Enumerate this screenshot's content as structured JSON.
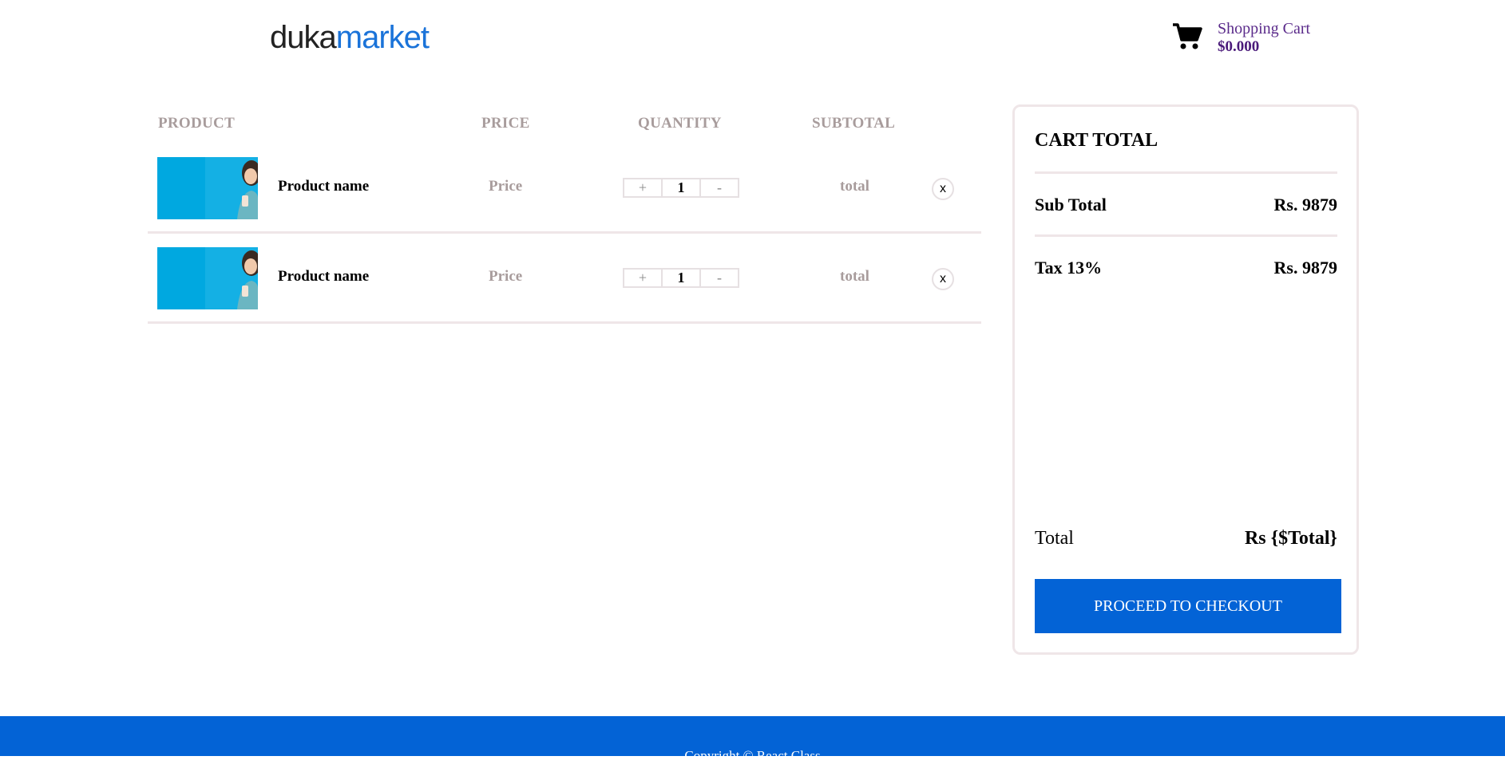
{
  "brand": {
    "logo_part1": "duka",
    "logo_part2": "market"
  },
  "header": {
    "cart_label": "Shopping Cart",
    "cart_amount": "$0.000",
    "cart_icon": "cart-icon"
  },
  "table": {
    "headers": {
      "product": "PRODUCT",
      "price": "PRICE",
      "quantity": "QUANTITY",
      "subtotal": "SUBTOTAL"
    },
    "rows": [
      {
        "name": "Product name",
        "price": "Price",
        "qty": "1",
        "plus": "+",
        "minus": "-",
        "total": "total",
        "remove": "x"
      },
      {
        "name": "Product name",
        "price": "Price",
        "qty": "1",
        "plus": "+",
        "minus": "-",
        "total": "total",
        "remove": "x"
      }
    ]
  },
  "cart_total": {
    "title": "CART TOTAL",
    "subtotal_label": "Sub Total",
    "subtotal_value": "Rs. 9879",
    "tax_label": "Tax 13%",
    "tax_value": "Rs. 9879",
    "total_label": "Total",
    "total_value": "Rs {$Total}",
    "checkout_label": "PROCEED TO CHECKOUT"
  },
  "footer": {
    "copyright": "Copyright © React Class"
  },
  "colors": {
    "accent": "#0363d6",
    "muted": "#a89c9c",
    "cart_text": "#5a2a8a",
    "divider": "#efe6e8",
    "thumb_bg": "#00a8e0"
  }
}
